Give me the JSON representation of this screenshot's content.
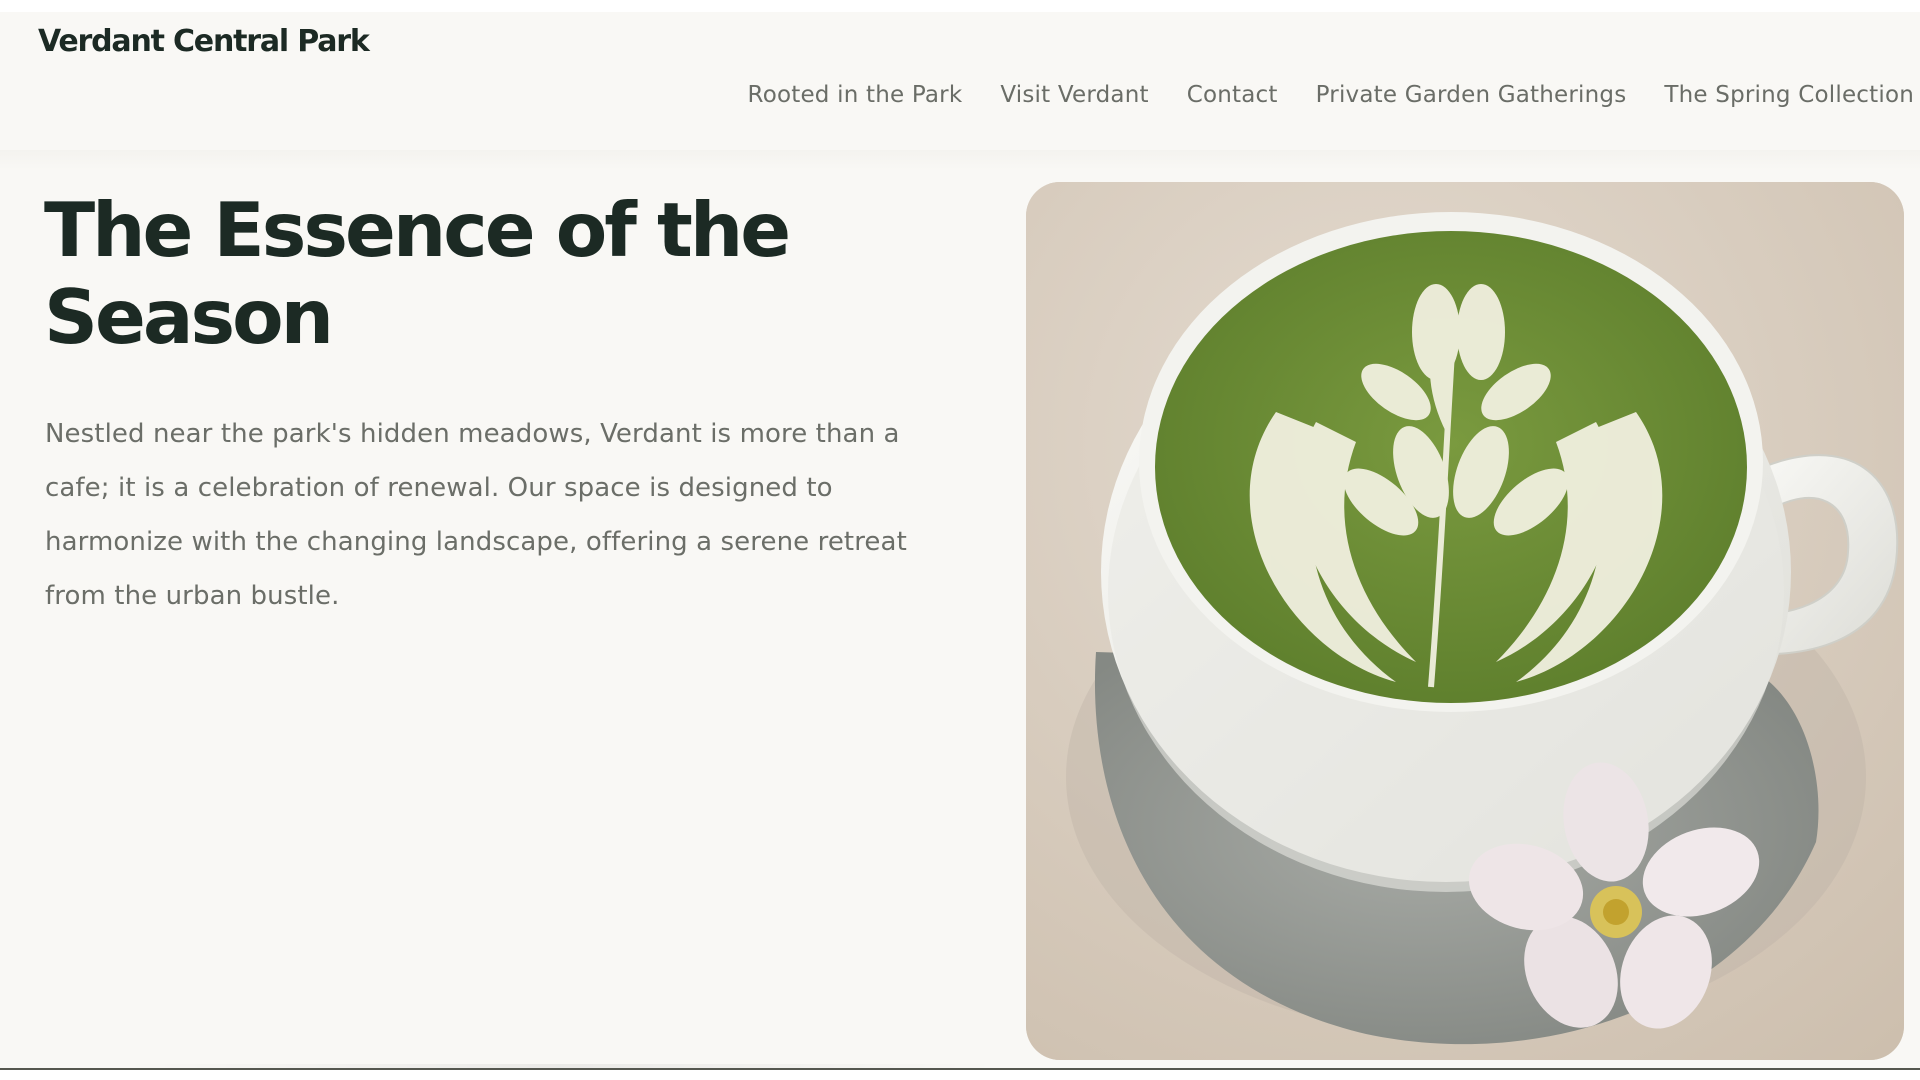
{
  "header": {
    "brand": "Verdant Central Park",
    "nav": [
      {
        "label": "Rooted in the Park"
      },
      {
        "label": "Visit Verdant"
      },
      {
        "label": "Contact"
      },
      {
        "label": "Private Garden Gatherings"
      },
      {
        "label": "The Spring Collection"
      }
    ]
  },
  "hero": {
    "headline_line1": "The Essence of the",
    "headline_line2": "Season",
    "intro_lines": [
      "Nestled near the park's hidden meadows, Verdant is more than a",
      "cafe; it is a celebration of renewal. Our space is designed to",
      "harmonize with the changing landscape, offering a serene retreat",
      "from the urban bustle."
    ]
  },
  "colors": {
    "background": "#f9f8f5",
    "heading": "#1c2a24",
    "body_text": "#6b6e68",
    "matcha": "#6f8f3a"
  },
  "image": {
    "subject": "matcha-latte-photo"
  }
}
